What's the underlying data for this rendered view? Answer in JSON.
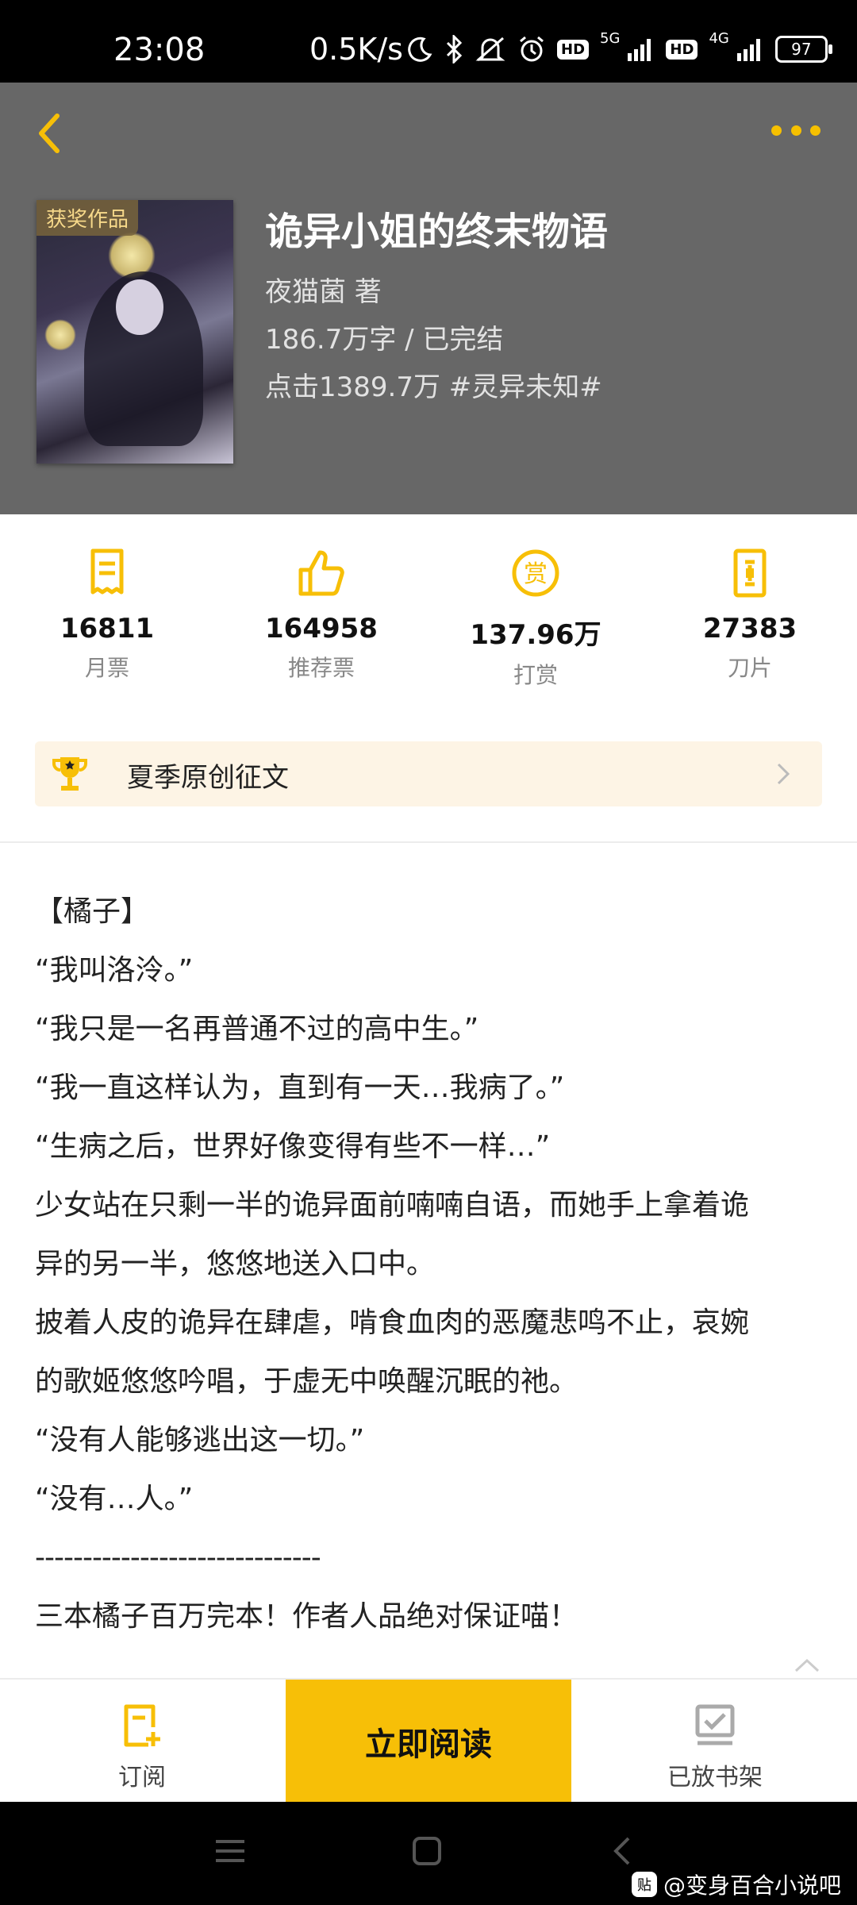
{
  "status_bar": {
    "time": "23:08",
    "net_speed": "0.5K/s",
    "sim1_type": "5G",
    "sim2_type": "4G",
    "hd_label": "HD",
    "battery": "97"
  },
  "book": {
    "award_badge": "获奖作品",
    "title": "诡异小姐的终末物语",
    "author_line": "夜猫菌  著",
    "words_status": "186.7万字 / 已完结",
    "clicks_tags": "点击1389.7万  #灵异未知#"
  },
  "stats": [
    {
      "icon": "monthly-ticket-icon",
      "value": "16811",
      "label": "月票"
    },
    {
      "icon": "thumbs-up-icon",
      "value": "164958",
      "label": "推荐票"
    },
    {
      "icon": "reward-icon",
      "value": "137.96万",
      "label": "打赏"
    },
    {
      "icon": "blade-icon",
      "value": "27383",
      "label": "刀片"
    }
  ],
  "event": {
    "label": "夏季原创征文"
  },
  "synopsis": [
    "【橘子】",
    "“我叫洛泠。”",
    "“我只是一名再普通不过的高中生。”",
    "“我一直这样认为，直到有一天…我病了。”",
    "“生病之后，世界好像变得有些不一样…”",
    "少女站在只剩一半的诡异面前喃喃自语，而她手上拿着诡",
    "异的另一半，悠悠地送入口中。",
    "披着人皮的诡异在肆虐，啃食血肉的恶魔悲鸣不止，哀婉",
    "的歌姬悠悠吟唱，于虚无中唤醒沉眠的祂。",
    "“没有人能够逃出这一切。”",
    "“没有…人。”",
    "------------------------------",
    "三本橘子百万完本！作者人品绝对保证喵！"
  ],
  "actions": {
    "subscribe": "订阅",
    "read_now": "立即阅读",
    "on_shelf": "已放书架"
  },
  "watermark": {
    "badge": "贴",
    "text": "@变身百合小说吧"
  },
  "colors": {
    "accent": "#f7bf07",
    "header_bg": "#676767"
  }
}
